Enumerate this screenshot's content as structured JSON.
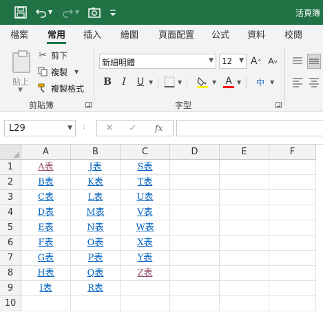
{
  "titlebar": {
    "title": "活頁簿"
  },
  "tabs": [
    {
      "label": "檔案"
    },
    {
      "label": "常用",
      "active": true
    },
    {
      "label": "插入"
    },
    {
      "label": "繪圖"
    },
    {
      "label": "頁面配置"
    },
    {
      "label": "公式"
    },
    {
      "label": "資料"
    },
    {
      "label": "校閱"
    }
  ],
  "ribbon": {
    "clipboard": {
      "paste_label": "貼上",
      "cut_label": "剪下",
      "copy_label": "複製",
      "format_painter_label": "複製格式",
      "group_label": "剪貼簿"
    },
    "font": {
      "font_name": "新細明體",
      "font_size": "12",
      "group_label": "字型",
      "bold": "B",
      "italic": "I",
      "underline": "U",
      "font_color_letter": "A",
      "phonetic_glyph": "中",
      "grow_glyph": "A",
      "shrink_glyph": "A"
    },
    "colors": {
      "fill": "#ffff00",
      "font": "#ff0000",
      "accent": "#217346"
    }
  },
  "formula_bar": {
    "name_box": "L29",
    "cancel_glyph": "✕",
    "enter_glyph": "✓",
    "fx_label": "fx",
    "formula": ""
  },
  "sheet": {
    "columns": [
      "A",
      "B",
      "C",
      "D",
      "E",
      "F"
    ],
    "rows": [
      "1",
      "2",
      "3",
      "4",
      "5",
      "6",
      "7",
      "8",
      "9",
      "10"
    ],
    "col_a": [
      "A表",
      "B表",
      "C表",
      "D表",
      "E表",
      "F表",
      "G表",
      "H表",
      "I表",
      ""
    ],
    "col_b": [
      "J表",
      "K表",
      "L表",
      "M表",
      "N表",
      "O表",
      "P表",
      "Q表",
      "R表",
      ""
    ],
    "col_c": [
      "S表",
      "T表",
      "U表",
      "V表",
      "W表",
      "X表",
      "Y表",
      "Z表",
      "",
      ""
    ],
    "link_color": "#0563c1",
    "visited_color": "#954f72"
  }
}
